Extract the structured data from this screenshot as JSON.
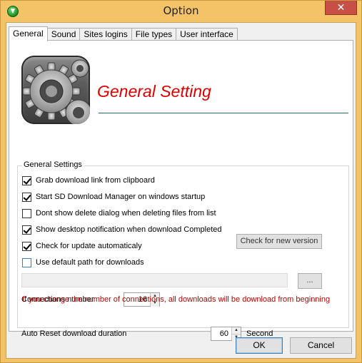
{
  "window": {
    "title": "Option",
    "close_label": "✕"
  },
  "tabs": [
    {
      "label": "General",
      "active": true
    },
    {
      "label": "Sound",
      "active": false
    },
    {
      "label": "Sites logins",
      "active": false
    },
    {
      "label": "File types",
      "active": false
    },
    {
      "label": "User interface",
      "active": false
    }
  ],
  "header": {
    "title": "General Setting"
  },
  "settings": {
    "group_label": "General Settings",
    "options": [
      {
        "label": "Grab download link from clipboard",
        "checked": true
      },
      {
        "label": "Start SD Download Manager on windows startup",
        "checked": true
      },
      {
        "label": "Dont show delete dialog when deleting files from list",
        "checked": false
      },
      {
        "label": "Show desktop notification when download Completed",
        "checked": true
      },
      {
        "label": "Check for update automaticaly",
        "checked": true
      },
      {
        "label": "Use default path for downloads",
        "checked": false
      }
    ],
    "check_version_label": "Check for new version",
    "path_value": "",
    "browse_label": "...",
    "connections_label": "Connections number",
    "connections_value": "16",
    "warning": "If you change the number of connections, all downloads will be download from beginning",
    "auto_reset_label": "Auto Reset download duration",
    "auto_reset_value": "60",
    "auto_reset_unit": "Second"
  },
  "footer": {
    "ok_label": "OK",
    "cancel_label": "Cancel"
  },
  "colors": {
    "title_bar": "#f4c367",
    "heading": "#e00000",
    "warning": "#b80000",
    "close": "#c74f45"
  },
  "icons": [
    "app-download-icon",
    "settings-gear-icon",
    "close-icon",
    "checkbox-icon",
    "spin-up-icon",
    "spin-down-icon"
  ]
}
